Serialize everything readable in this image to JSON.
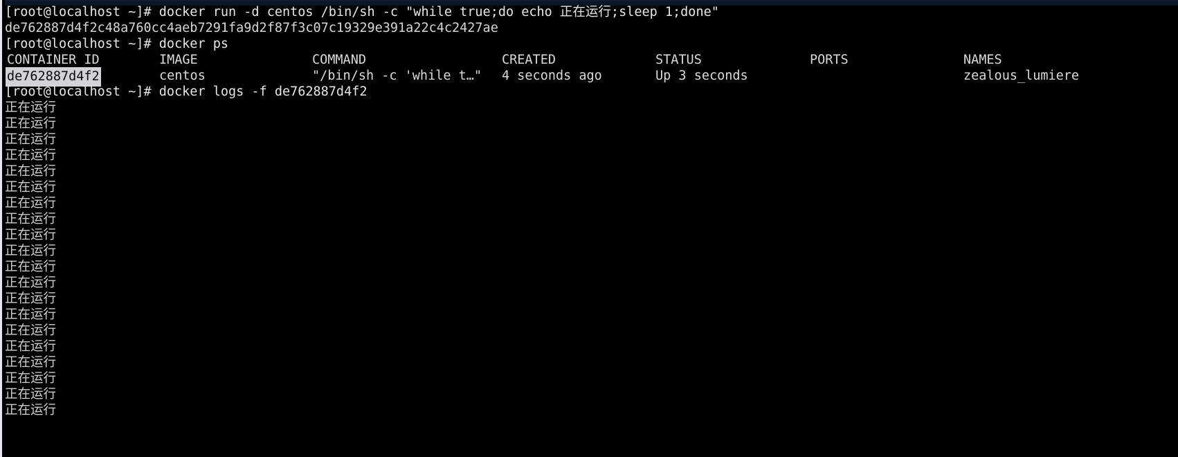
{
  "terminal": {
    "background_color": "#000000",
    "foreground_color": "#d6d6d6",
    "selection_background": "#d3d3d7",
    "selection_foreground": "#0a0a0a",
    "titlebar_color": "#0a1526",
    "prompt": "[root@localhost ~]#"
  },
  "lines": {
    "cmd_run": "[root@localhost ~]# docker run -d centos /bin/sh -c \"while true;do echo 正在运行;sleep 1;done\"",
    "container_hash": "de762887d4f2c48a760cc4aeb7291fa9d2f87f3c07c19329e391a22c4c2427ae",
    "cmd_ps": "[root@localhost ~]# docker ps",
    "cmd_logs": "[root@localhost ~]# docker logs -f de762887d4f2"
  },
  "commands": {
    "run": {
      "prompt": "[root@localhost ~]#",
      "text": " docker run -d centos /bin/sh -c \"while true;do echo 正在运行;sleep 1;done\""
    },
    "ps": {
      "prompt": "[root@localhost ~]#",
      "text": " docker ps"
    },
    "logs": {
      "prompt": "[root@localhost ~]#",
      "text": " docker logs -f de762887d4f2"
    }
  },
  "docker_ps_table": {
    "headers": [
      "CONTAINER ID",
      "IMAGE",
      "COMMAND",
      "CREATED",
      "STATUS",
      "PORTS",
      "NAMES"
    ],
    "rows": [
      {
        "container_id": "de762887d4f2",
        "image": "centos",
        "command": "\"/bin/sh -c 'while t…\"",
        "created": "4 seconds ago",
        "status": "Up 3 seconds",
        "ports": "",
        "names": "zealous_lumiere",
        "container_id_selected": true
      }
    ]
  },
  "log_output": {
    "message": "正在运行",
    "repeat_count": 20,
    "last_line_clipped": true
  }
}
